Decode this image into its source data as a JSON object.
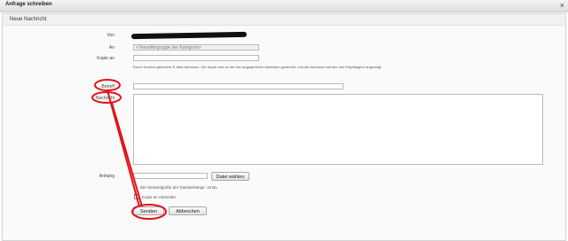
{
  "window": {
    "title": "Anfrage schreiben",
    "close_glyph": "×"
  },
  "panel": {
    "title": "Neue Nachricht"
  },
  "form": {
    "von_label": "Von",
    "an_label": "An",
    "an_value": "<Verwaltergruppe der Kategorie>",
    "kopie_label": "Kopie an",
    "kopie_value": "",
    "note": "Durch Komma getrennte E-Mail-Adressen. Die Kopie wird an die hier angegebenen Adressen gesendet, und die Adressen werden den Empfängern angezeigt.",
    "betreff_label": "Betreff",
    "betreff_value": "",
    "nachricht_label": "Nachricht",
    "nachricht_value": "",
    "anhang_label": "Anhang",
    "anhang_value": "",
    "datei_button": "Datei wählen",
    "size_note": "Die Gesamtgröße der Dateianhänge: 10 Bu",
    "copy_checkbox_label": "Kopie an Absender",
    "send_button": "Senden",
    "cancel_button": "Abbrechen"
  },
  "annotation_color": "#e0121b"
}
